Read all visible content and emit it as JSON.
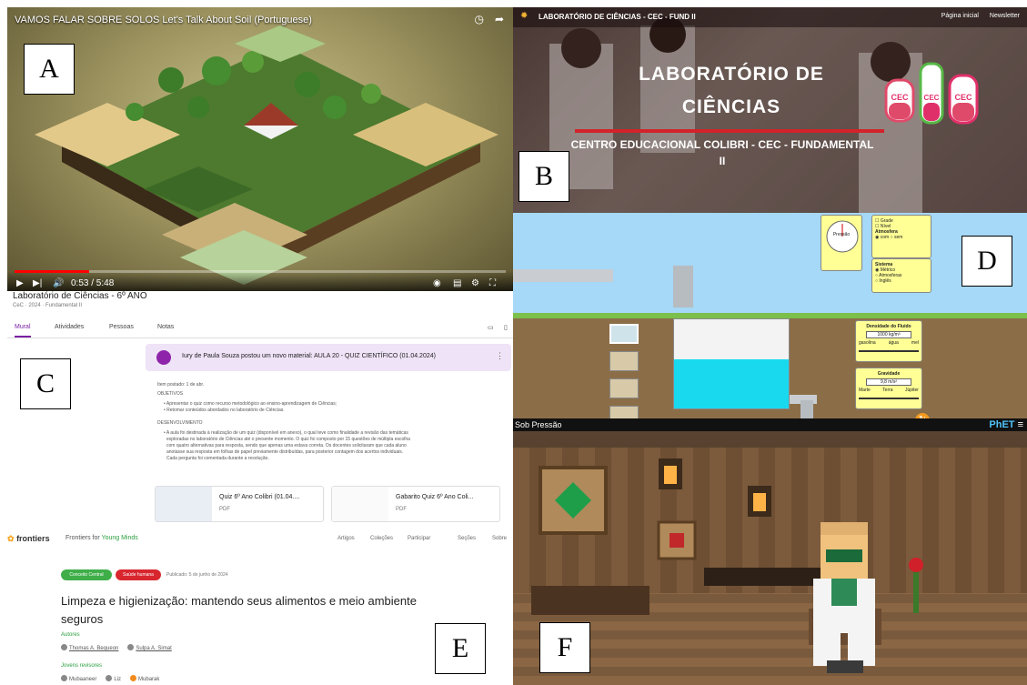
{
  "labels": {
    "a": "A",
    "b": "B",
    "c": "C",
    "d": "D",
    "e": "E",
    "f": "F"
  },
  "video": {
    "title": "VAMOS FALAR SOBRE SOLOS Let's Talk About Soil (Portuguese)",
    "time": "0:53 / 5:48",
    "progress": 0.152
  },
  "lab": {
    "site_title": "LABORATÓRIO DE CIÊNCIAS - CEC - FUND II",
    "nav": [
      "Página inicial",
      "Newsletter"
    ],
    "heading_line1": "LABORATÓRIO DE",
    "heading_line2": "CIÊNCIAS",
    "subtitle_line1": "CENTRO EDUCACIONAL COLIBRI - CEC - FUNDAMENTAL",
    "subtitle_line2": "II",
    "flask_labels": [
      "CEC",
      "CEC",
      "CEC"
    ]
  },
  "classroom": {
    "class_name": "Laboratório de Ciências - 6º ANO",
    "breadcrumb": "CeC · 2024 · Fundamental II",
    "tabs": [
      "Mural",
      "Atividades",
      "Pessoas",
      "Notas"
    ],
    "post_title": "Iury de Paula Souza postou um novo material: AULA 20 - QUIZ CIENTÍFICO (01.04.2024)",
    "posted": "Item postado: 1 de abr.",
    "objetivos": "OBJETIVOS",
    "objetivo_1": "• Apresentar o quiz como recurso metodológico ao ensino-aprendizagem de Ciências;",
    "objetivo_2": "• Retomar conteúdos abordados no laboratório de Ciências.",
    "desenvolvimento": "DESENVOLVIMENTO",
    "desc_1": "• A aula foi destinada à realização de um quiz (disponível em anexo), o qual teve como finalidade a revisão das temáticas",
    "desc_2": "exploradas no laboratório de Ciências até o presente momento. O quiz foi composto por 15 questões de múltipla escolha",
    "desc_3": "com quatro alternativas para resposta, sendo que apenas uma estava correta. Os docentes solicitaram que cada aluno",
    "desc_4": "anotasse sua resposta em folhas de papel previamente distribuídas, para posterior contagem dos acertos individuais.",
    "desc_5": "Cada pergunta foi comentada durante a resolução.",
    "attachments": [
      {
        "name": "Quiz 6º Ano Colibri (01.04....",
        "type": "PDF"
      },
      {
        "name": "Gabarito Quiz 6º Ano Coli...",
        "type": "PDF"
      }
    ]
  },
  "sim": {
    "checkbox_1": "Grade",
    "checkbox_2": "Nível",
    "atm_title": "Atmosfera",
    "atm_on": "com",
    "atm_off": "sem",
    "units_title": "Sistema",
    "units": [
      "Métrico",
      "Atmosferas",
      "Inglês"
    ],
    "density_title": "Densidade do Fluido",
    "density_value": "1000 kg/m³",
    "density_ticks": [
      "gasolina",
      "água",
      "mel"
    ],
    "gravity_title": "Gravidade",
    "gravity_value": "9,8 m/s²",
    "gravity_ticks": [
      "Marte",
      "Terra",
      "Júpiter"
    ],
    "gauge_label": "Pressão",
    "sim_name": "Sob Pressão",
    "brand": "PhET"
  },
  "frontiers": {
    "logo": "frontiers",
    "product_prefix": "Frontiers for ",
    "product_suffix": "Young Minds",
    "menu": [
      "Artigos",
      "Coleções",
      "Participar",
      "Seções",
      "Sobre"
    ],
    "badge_1": "Conceito Central",
    "badge_2": "Saúde humana",
    "published": "Publicado: 5 de junho de 2024",
    "title": "Limpeza e higienização: mantendo seus alimentos e meio ambiente seguros",
    "authors_label": "Autores",
    "authors": [
      "Thomas A. Bequeon",
      "Sulpa A. Simat"
    ],
    "reviewers_label": "Jovens revisores",
    "reviewers": [
      "Mubaaneer",
      "Liz",
      "Mubarak"
    ]
  },
  "colors": {
    "video_progress": "#ff0000",
    "lab_red": "#d3222a",
    "classroom_purple": "#8e24aa",
    "fym_green": "#2b9e3e",
    "water": "#19d9ef",
    "sim_panel": "#ffff96"
  }
}
